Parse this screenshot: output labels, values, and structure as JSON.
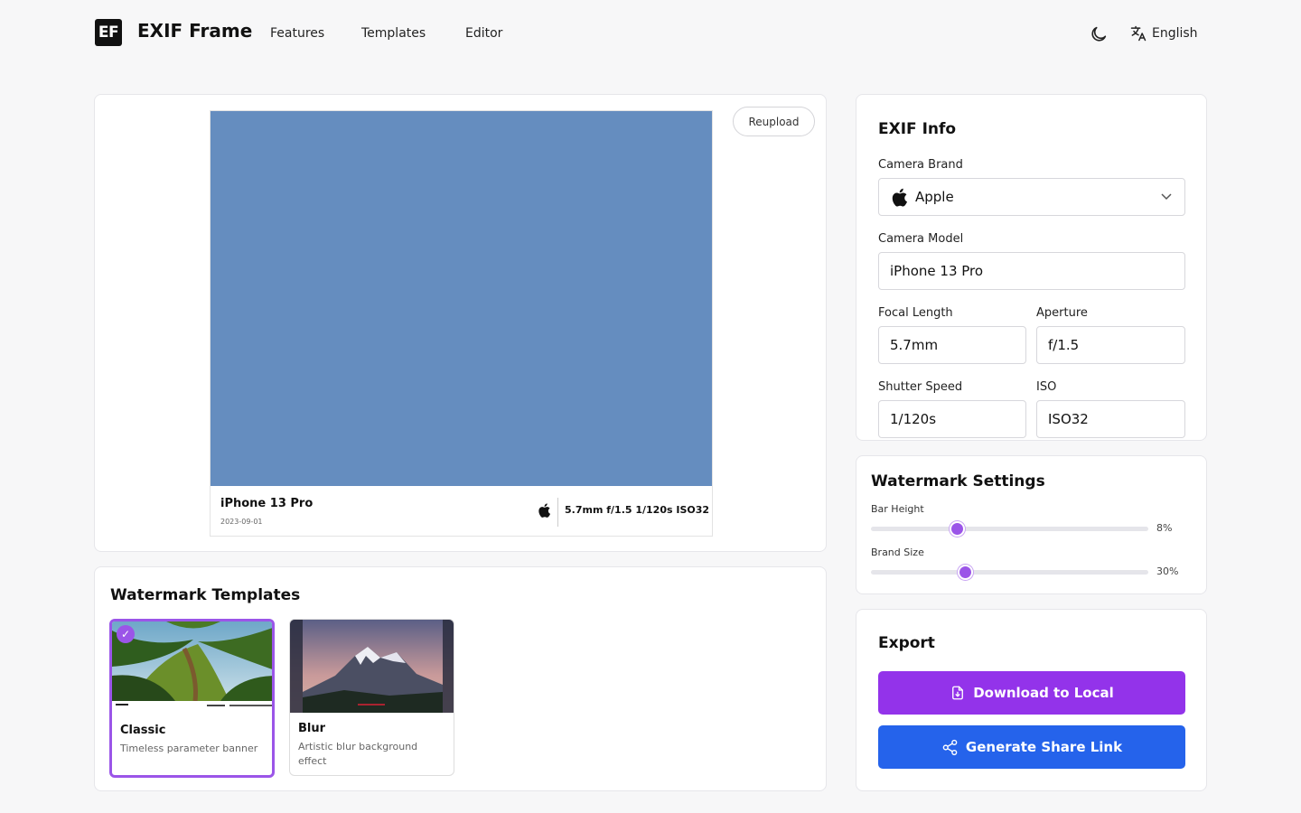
{
  "app": {
    "logo_text": "EF",
    "title": "EXIF Frame"
  },
  "nav": {
    "features": "Features",
    "templates": "Templates",
    "editor": "Editor"
  },
  "header": {
    "language": "English",
    "theme_icon": "moon-icon",
    "language_icon": "translate-icon"
  },
  "preview": {
    "reupload_label": "Reupload",
    "photo_color": "#658dbf",
    "watermark": {
      "model": "iPhone 13 Pro",
      "date": "2023-09-01",
      "brand_icon": "apple-logo-icon",
      "params": "5.7mm  f/1.5  1/120s  ISO32"
    }
  },
  "templates": {
    "title": "Watermark Templates",
    "items": [
      {
        "name": "Classic",
        "description": "Timeless parameter banner",
        "selected": true
      },
      {
        "name": "Blur",
        "description": "Artistic blur background effect",
        "selected": false
      }
    ]
  },
  "exif": {
    "title": "EXIF Info",
    "camera_brand": {
      "label": "Camera Brand",
      "value": "Apple"
    },
    "camera_model": {
      "label": "Camera Model",
      "value": "iPhone 13 Pro"
    },
    "focal_length": {
      "label": "Focal Length",
      "value": "5.7mm"
    },
    "aperture": {
      "label": "Aperture",
      "value": "f/1.5"
    },
    "shutter_speed": {
      "label": "Shutter Speed",
      "value": "1/120s"
    },
    "iso": {
      "label": "ISO",
      "value": "ISO32"
    }
  },
  "watermark_settings": {
    "title": "Watermark Settings",
    "bar_height": {
      "label": "Bar Height",
      "value_text": "8%",
      "fraction": 0.31
    },
    "brand_size": {
      "label": "Brand Size",
      "value_text": "30%",
      "fraction": 0.34
    }
  },
  "export": {
    "title": "Export",
    "download_label": "Download to Local",
    "share_label": "Generate Share Link"
  },
  "colors": {
    "accent": "#9333ea",
    "share_blue": "#2563eb",
    "slider": "#9b55e8"
  }
}
